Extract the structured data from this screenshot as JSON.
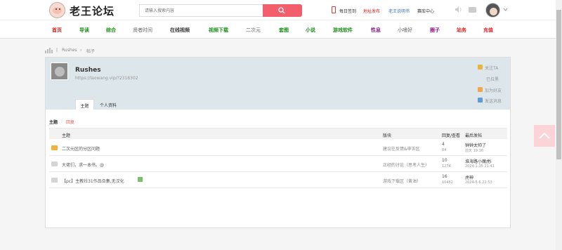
{
  "header": {
    "site_name": "老王论坛",
    "search_placeholder": "请输入搜索内容",
    "links": [
      "每日签到",
      "地址发布",
      "老王说明书",
      "赛库中心"
    ]
  },
  "nav": {
    "items": [
      {
        "label": "首页",
        "color": "#e02020"
      },
      {
        "label": "导读",
        "color": "#1a8f1a"
      },
      {
        "label": "综合",
        "color": "#1a8f1a"
      },
      {
        "label": "贤者时间",
        "color": "#666666"
      },
      {
        "label": "在线视频",
        "color": "#333333"
      },
      {
        "label": "视频下载",
        "color": "#1a8f1a"
      },
      {
        "label": "二次元",
        "color": "#666666"
      },
      {
        "label": "套图",
        "color": "#1a8f1a"
      },
      {
        "label": "小说",
        "color": "#1a8f1a"
      },
      {
        "label": "游戏软件",
        "color": "#1a8f1a"
      },
      {
        "label": "性息",
        "color": "#8a1a8a"
      },
      {
        "label": "小嗜好",
        "color": "#666666"
      },
      {
        "label": "圈子",
        "color": "#8a1a8a"
      },
      {
        "label": "站务",
        "color": "#e02020"
      },
      {
        "label": "充值",
        "color": "#e02020"
      }
    ]
  },
  "breadcrumb": {
    "user": "Rushes",
    "sep": "›",
    "current": "帖子"
  },
  "profile": {
    "name": "Rushes",
    "url": "https://laowang.vip/?2318302",
    "tabs": [
      "主题",
      "个人资料"
    ],
    "actions": [
      "关注TA",
      "已拉黑",
      "加为好友",
      "发送消息"
    ]
  },
  "threads": {
    "sub_tabs": [
      "主题",
      "回复"
    ],
    "headers": {
      "subject": "主题",
      "forum": "版块",
      "replies_views": "回复/查看",
      "last_post": "最后发帖"
    },
    "rows": [
      {
        "title": "二次元区的分区问题",
        "forum": "建议在反馈&申诉区",
        "replies": "4",
        "views": "84",
        "last_user": "钟钟太帅了",
        "last_time": "前天 19:16",
        "icon_color": "#f5b23a"
      },
      {
        "title": "大佬们，求一本书。@",
        "forum": "正经的讨论（思考人生）",
        "replies": "10",
        "views": "1274",
        "last_user": "淮海路小魔虎i",
        "last_time": "2024-1-15 21:41",
        "icon_color": "#d5d5d5"
      },
      {
        "title": "【pc】主教社31作品合集,无汉化",
        "forum": "游戏下载区（黄油）",
        "replies": "16",
        "views": "10482",
        "last_user": "虎神",
        "last_time": "2024-5-6 22:53",
        "icon_color": "#d5d5d5"
      }
    ]
  }
}
